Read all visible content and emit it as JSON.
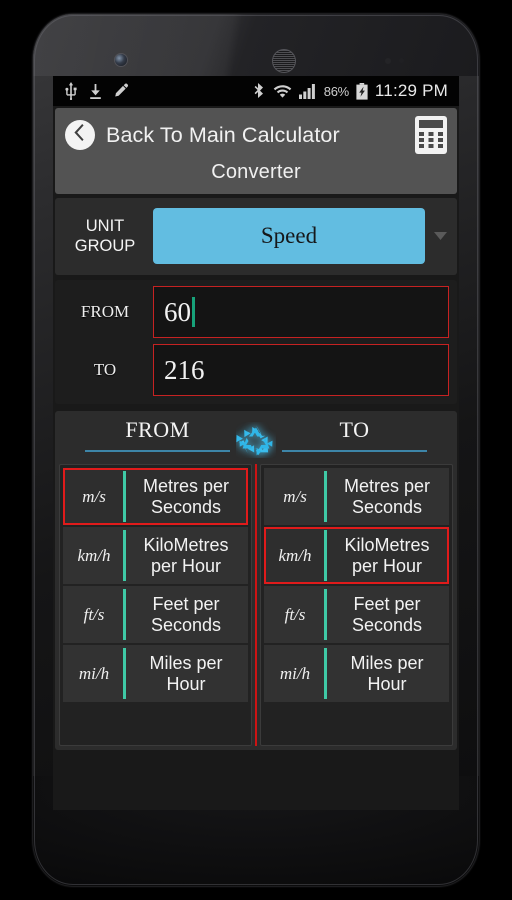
{
  "status_bar": {
    "left_icons": [
      "usb-icon",
      "download-icon",
      "edit-pencil-icon"
    ],
    "right_icons": [
      "bluetooth-icon",
      "wifi-icon",
      "signal-icon",
      "battery-charging-icon"
    ],
    "battery_percent": "86%",
    "clock": "11:29 PM"
  },
  "header": {
    "back_icon": "chevron-left-icon",
    "title": "Back To Main Calculator",
    "calculator_icon": "calculator-icon",
    "subtitle": "Converter"
  },
  "unit_group": {
    "label": "UNIT\nGROUP",
    "label_line1": "UNIT",
    "label_line2": "GROUP",
    "selected": "Speed",
    "caret_icon": "chevron-down-icon",
    "spinner_color": "#62bde1",
    "options": [
      "Speed"
    ]
  },
  "conversion": {
    "from_label": "FROM",
    "from_value": "60",
    "from_placeholder": "",
    "to_label": "TO",
    "to_value": "216",
    "to_placeholder": "",
    "field_border_color": "#c62222",
    "caret_color": "#17a27a"
  },
  "tabs": {
    "from": {
      "label": "FROM",
      "underline_color": "#3d85a8"
    },
    "to": {
      "label": "TO",
      "underline_color": "#3d85a8"
    },
    "swap_icon": "recycle-swap-icon",
    "swap_icon_color": "#2fb6e8"
  },
  "unit_lists": {
    "divider_color": "#3fc9a6",
    "column_divider_color": "#cc1414",
    "selection_color": "#e01b1b",
    "from": {
      "selected_index": 0,
      "items": [
        {
          "symbol": "m/s",
          "name": "Metres per Seconds"
        },
        {
          "symbol": "km/h",
          "name": "KiloMetres per Hour"
        },
        {
          "symbol": "ft/s",
          "name": "Feet per Seconds"
        },
        {
          "symbol": "mi/h",
          "name": "Miles per Hour"
        }
      ]
    },
    "to": {
      "selected_index": 1,
      "items": [
        {
          "symbol": "m/s",
          "name": "Metres per Seconds"
        },
        {
          "symbol": "km/h",
          "name": "KiloMetres per Hour"
        },
        {
          "symbol": "ft/s",
          "name": "Feet per Seconds"
        },
        {
          "symbol": "mi/h",
          "name": "Miles per Hour"
        }
      ]
    }
  }
}
